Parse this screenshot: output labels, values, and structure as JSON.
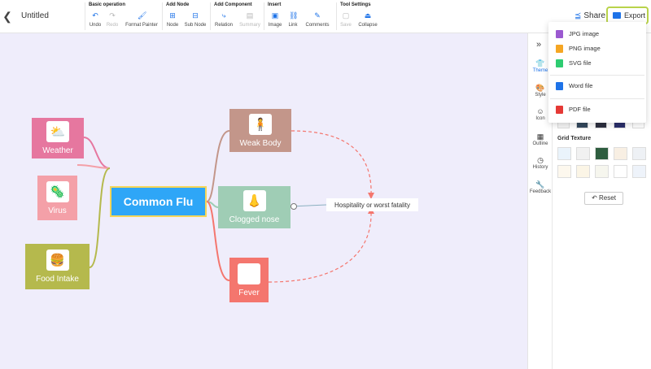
{
  "document": {
    "title": "Untitled"
  },
  "toolbar": {
    "groups": [
      {
        "title": "Basic operation",
        "tools": [
          {
            "label": "Undo",
            "icon": "undo-icon",
            "glyph": "↶",
            "disabled": false
          },
          {
            "label": "Redo",
            "icon": "redo-icon",
            "glyph": "↷",
            "disabled": true
          },
          {
            "label": "Format Painter",
            "icon": "format-painter-icon",
            "glyph": "🖌",
            "disabled": false
          }
        ]
      },
      {
        "title": "Add Node",
        "tools": [
          {
            "label": "Node",
            "icon": "node-icon",
            "glyph": "⊞",
            "disabled": false
          },
          {
            "label": "Sub Node",
            "icon": "sub-node-icon",
            "glyph": "⊟",
            "disabled": false
          }
        ]
      },
      {
        "title": "Add Component",
        "tools": [
          {
            "label": "Relation",
            "icon": "relation-icon",
            "glyph": "⤷",
            "disabled": false
          },
          {
            "label": "Summary",
            "icon": "summary-icon",
            "glyph": "▤",
            "disabled": true
          }
        ]
      },
      {
        "title": "Insert",
        "tools": [
          {
            "label": "Image",
            "icon": "image-icon",
            "glyph": "▣",
            "disabled": false
          },
          {
            "label": "Link",
            "icon": "link-icon",
            "glyph": "⛓",
            "disabled": false
          },
          {
            "label": "Comments",
            "icon": "comments-icon",
            "glyph": "✎",
            "disabled": false
          }
        ]
      },
      {
        "title": "Tool Settings",
        "tools": [
          {
            "label": "Save",
            "icon": "save-icon",
            "glyph": "▢",
            "disabled": true
          },
          {
            "label": "Collapse",
            "icon": "collapse-icon",
            "glyph": "⏏",
            "disabled": false
          }
        ]
      }
    ],
    "share_label": "Share",
    "export_label": "Export"
  },
  "export_menu": {
    "items": [
      {
        "label": "JPG image",
        "icon": "jpg-file-icon",
        "color": "#9b59d0"
      },
      {
        "label": "PNG image",
        "icon": "png-file-icon",
        "color": "#f5a623"
      },
      {
        "label": "SVG file",
        "icon": "svg-file-icon",
        "color": "#2ecc71"
      },
      {
        "label": "Word file",
        "icon": "word-file-icon",
        "color": "#1e73e8"
      },
      {
        "label": "PDF file",
        "icon": "pdf-file-icon",
        "color": "#e53935"
      }
    ]
  },
  "mindmap": {
    "root": "Common Flu",
    "left_nodes": [
      {
        "label": "Weather",
        "color": "#e6779f",
        "icon": "weather-icon",
        "glyph": "⛅"
      },
      {
        "label": "Virus",
        "color": "#f4a0a8",
        "icon": "virus-icon",
        "glyph": "🦠"
      },
      {
        "label": "Food Intake",
        "color": "#b5b94d",
        "icon": "food-icon",
        "glyph": "🍔"
      }
    ],
    "right_nodes": [
      {
        "label": "Weak Body",
        "color": "#c3968a",
        "icon": "weak-body-icon",
        "glyph": "🧍"
      },
      {
        "label": "Clogged nose",
        "color": "#9fcdb5",
        "icon": "nose-icon",
        "glyph": "👃"
      },
      {
        "label": "Fever",
        "color": "#f4766e",
        "icon": "thermometer-icon",
        "glyph": "🌡"
      }
    ],
    "relation_label": "Hospitality or worst fatality"
  },
  "side_panel": {
    "tabs": [
      {
        "label": "Theme",
        "icon": "theme-icon",
        "glyph": "👕",
        "active": true
      },
      {
        "label": "Style",
        "icon": "style-icon",
        "glyph": "🎨",
        "active": false
      },
      {
        "label": "Icon",
        "icon": "emoji-icon",
        "glyph": "☺",
        "active": false
      },
      {
        "label": "Outline",
        "icon": "outline-icon",
        "glyph": "▦",
        "active": false
      },
      {
        "label": "History",
        "icon": "history-icon",
        "glyph": "◷",
        "active": false
      },
      {
        "label": "Feedback",
        "icon": "feedback-icon",
        "glyph": "🔧",
        "active": false
      }
    ],
    "grid_texture_label": "Grid Texture",
    "reset_label": "Reset",
    "theme_colors": [
      "#f5f5f5",
      "#34495e",
      "#2d3040",
      "#2b2f6b",
      "#ffffff"
    ],
    "grid_textures": [
      "#eaf3fb",
      "#f1f1f1",
      "#2e5d3f",
      "#f8efe3",
      "#eef1f5",
      "#fdf8ee",
      "#fbf5e6",
      "#f6f6ee",
      "#ffffff",
      "#eef3fa"
    ]
  }
}
